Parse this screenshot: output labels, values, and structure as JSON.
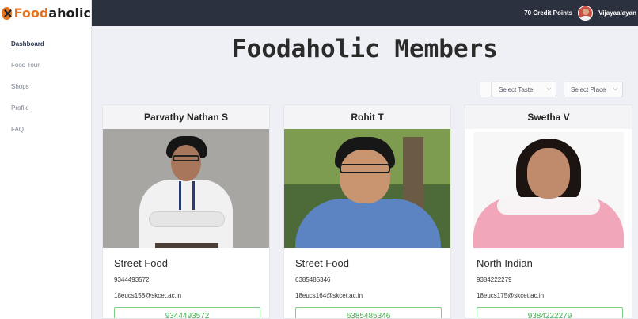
{
  "app": {
    "logo_part1": "Food",
    "logo_part2": "aholic"
  },
  "sidebar": {
    "items": [
      {
        "label": "Dashboard"
      },
      {
        "label": "Food Tour"
      },
      {
        "label": "Shops"
      },
      {
        "label": "Profile"
      },
      {
        "label": "FAQ"
      }
    ]
  },
  "topbar": {
    "credits": "70 Credit Points",
    "username": "Vijayaalayan"
  },
  "page": {
    "title": "Foodaholic Members"
  },
  "filters": {
    "taste": "Select Taste",
    "place": "Select Place"
  },
  "members": [
    {
      "name": "Parvathy Nathan S",
      "category": "Street Food",
      "phone": "9344493572",
      "email": "18eucs158@skcet.ac.in",
      "button": "9344493572"
    },
    {
      "name": "Rohit T",
      "category": "Street Food",
      "phone": "6385485346",
      "email": "18eucs164@skcet.ac.in",
      "button": "6385485346"
    },
    {
      "name": "Swetha V",
      "category": "North Indian",
      "phone": "9384222279",
      "email": "18eucs175@skcet.ac.in",
      "button": "9384222279"
    }
  ],
  "colors": {
    "accent": "#e8731f",
    "topbar": "#2c313f",
    "call_button": "#43b14c",
    "background": "#eef0f5"
  }
}
